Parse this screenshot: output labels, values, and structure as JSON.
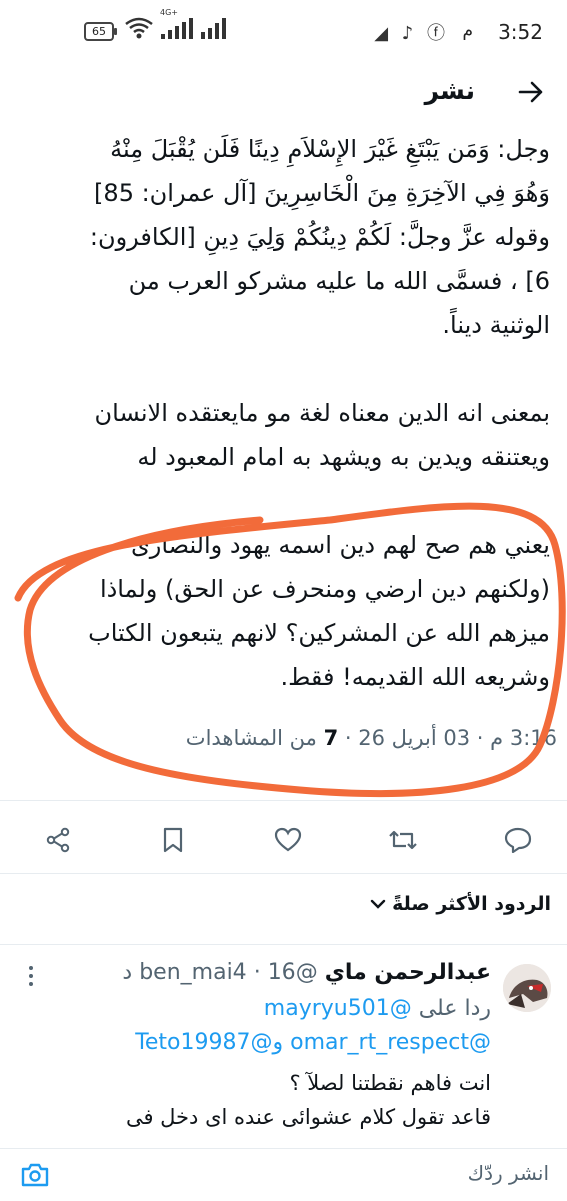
{
  "status_bar": {
    "time": "3:52",
    "ampm": "م",
    "battery": "65",
    "network": "4G+",
    "app_icons": "◢ ♪ ⓕ"
  },
  "header": {
    "title": "نشر"
  },
  "tweet": {
    "lines": [
      "وجل: وَمَن يَبْتَغِ غَيْرَ الإِسْلاَمِ دِينًا فَلَن يُقْبَلَ مِنْهُ",
      "وَهُوَ فِي الآخِرَةِ مِنَ الْخَاسِرِينَ [آل عمران: 85]",
      "وقوله عزَّ وجلَّ: لَكُمْ دِينُكُمْ وَلِيَ دِينِ [الكافرون:",
      "6] ، فسمَّى الله ما عليه مشركو العرب من",
      "الوثنية ديناً."
    ],
    "para2": [
      "بمعنى انه الدين معناه لغة مو مايعتقده الانسان",
      "ويعتنقه ويدين به ويشهد به امام المعبود له"
    ],
    "para3": [
      "يعني هم صح لهم دين اسمه يهود والنصارى",
      "(ولكنهم دين ارضي ومنحرف عن الحق) ولماذا",
      "ميزهم الله عن المشركين؟ لانهم يتبعون الكتاب",
      "وشريعه الله القديمه! فقط."
    ],
    "time": "3:16 م",
    "date": "03 أبريل 26",
    "views_count": "7",
    "views_label": "من المشاهدات"
  },
  "sort": {
    "label": "الردود الأكثر صلةً"
  },
  "reply": {
    "name": "عبدالرحمن ماي",
    "handle": "@ben_mai4",
    "age": "16 د",
    "reply_to_prefix": "ردا على",
    "reply_to_user": "@mayryu501",
    "mentions": "@omar_rt_respect و@Teto19987",
    "body": [
      "انت فاهم  نقطتنا لصلآ ؟",
      "قاعد تقول كلام عشوائى عنده اى دخل فى"
    ]
  },
  "compose": {
    "placeholder": "انشر ردّك"
  },
  "colors": {
    "accent": "#1d9bf0",
    "scribble": "#f26b3a",
    "text": "#0f1419",
    "muted": "#536471"
  }
}
